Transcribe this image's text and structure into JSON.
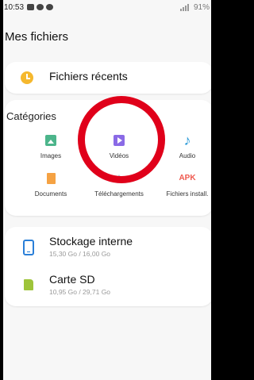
{
  "statusbar": {
    "time": "10:53",
    "battery": "91%"
  },
  "page": {
    "title": "Mes fichiers"
  },
  "recent": {
    "label": "Fichiers récents"
  },
  "categories": {
    "title": "Catégories",
    "items": [
      {
        "label": "Images",
        "icon": "image-icon"
      },
      {
        "label": "Vidéos",
        "icon": "video-icon"
      },
      {
        "label": "Audio",
        "icon": "audio-icon"
      },
      {
        "label": "Documents",
        "icon": "document-icon"
      },
      {
        "label": "Téléchargements",
        "icon": "download-icon"
      },
      {
        "label": "Fichiers install.",
        "icon": "apk-icon",
        "icon_text": "APK"
      }
    ]
  },
  "storage": [
    {
      "name": "Stockage interne",
      "usage": "15,30 Go / 16,00 Go"
    },
    {
      "name": "Carte SD",
      "usage": "10,95 Go / 29,71 Go"
    }
  ],
  "colors": {
    "accent_yellow": "#f5b82e",
    "highlight_ring": "#e0001a",
    "video": "#8a6ae6",
    "image": "#4cb58b",
    "audio": "#2a9ad8",
    "document": "#f5a243",
    "download": "#3aa9c9",
    "apk": "#ef5a4f"
  }
}
